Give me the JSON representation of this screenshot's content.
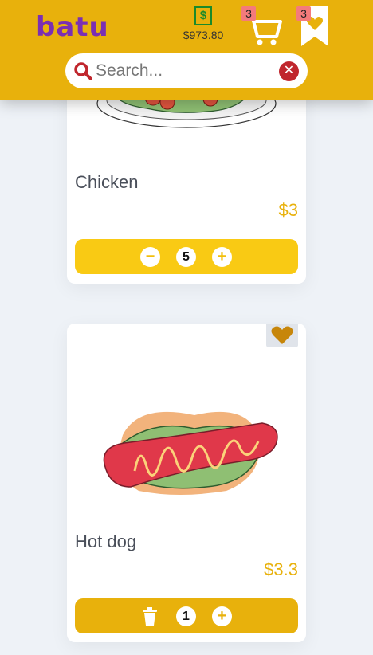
{
  "app": {
    "logo": "batu"
  },
  "header": {
    "wallet_amount": "$973.80",
    "cart_count": "3",
    "wishlist_count": "3",
    "colors": {
      "brand": "#e8b10c",
      "logo": "#7b2fb3",
      "badge": "#f47b7b"
    }
  },
  "search": {
    "placeholder": "Search...",
    "value": ""
  },
  "products": [
    {
      "name": "Chicken",
      "price": "$3",
      "quantity": "5",
      "minus_label": "−",
      "plus_label": "+"
    },
    {
      "name": "Hot dog",
      "price": "$3.3",
      "quantity": "1",
      "plus_label": "+"
    }
  ],
  "icons": [
    "dollar-icon",
    "cart-icon",
    "bookmark-heart-icon",
    "search-icon",
    "clear-icon",
    "minus-icon",
    "plus-icon",
    "trash-icon",
    "heart-icon"
  ]
}
